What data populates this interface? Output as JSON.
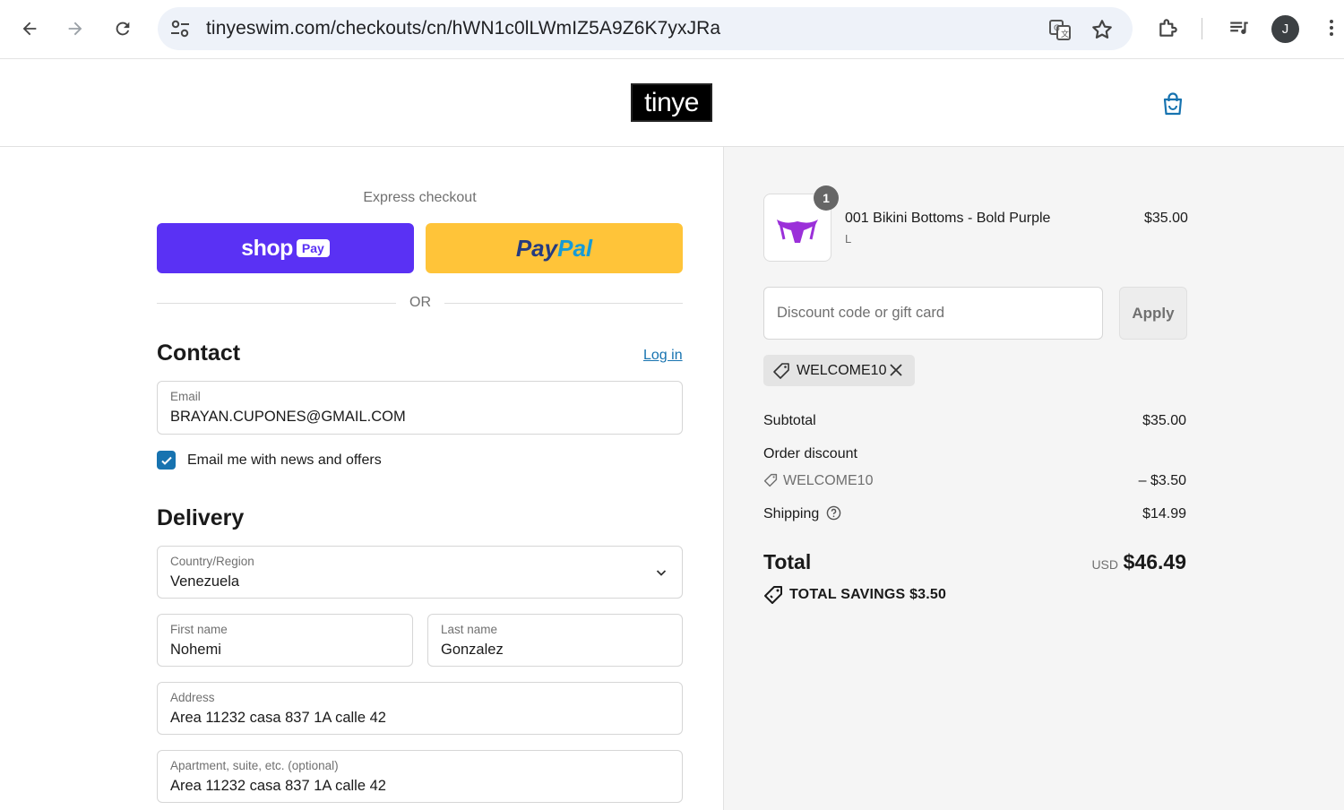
{
  "browser": {
    "url": "tinyeswim.com/checkouts/cn/hWN1c0lLWmIZ5A9Z6K7yxJRa",
    "avatar_initial": "J",
    "icons": [
      "back-arrow-icon",
      "forward-arrow-icon",
      "reload-icon",
      "site-settings-icon",
      "translate-icon",
      "star-icon",
      "extensions-icon",
      "media-queue-icon",
      "more-vert-icon"
    ]
  },
  "shop": {
    "logo_text": "tinye",
    "cart_icon": "bag-icon"
  },
  "checkout": {
    "express_title": "Express checkout",
    "shop_pay": {
      "word": "shop",
      "badge": "Pay"
    },
    "paypal": {
      "part1": "Pay",
      "part2": "Pal"
    },
    "or_text": "OR",
    "contact": {
      "title": "Contact",
      "login_link": "Log in",
      "email_label": "Email",
      "email_value": "BRAYAN.CUPONES@GMAIL.COM",
      "newsletter_label": "Email me with news and offers",
      "newsletter_checked": true
    },
    "delivery": {
      "title": "Delivery",
      "country_label": "Country/Region",
      "country_value": "Venezuela",
      "first_name_label": "First name",
      "first_name_value": "Nohemi",
      "last_name_label": "Last name",
      "last_name_value": "Gonzalez",
      "address_label": "Address",
      "address_value": "Area 11232 casa 837 1A calle 42",
      "apartment_label": "Apartment, suite, etc. (optional)",
      "apartment_value": "Area 11232 casa 837 1A calle 42"
    }
  },
  "summary": {
    "item": {
      "quantity": "1",
      "name": "001 Bikini Bottoms - Bold Purple",
      "variant": "L",
      "price": "$35.00"
    },
    "discount_placeholder": "Discount code or gift card",
    "apply_label": "Apply",
    "applied_code": "WELCOME10",
    "subtotal_label": "Subtotal",
    "subtotal_value": "$35.00",
    "order_discount_label": "Order discount",
    "discount_code": "WELCOME10",
    "discount_value": "– $3.50",
    "shipping_label": "Shipping",
    "shipping_value": "$14.99",
    "total_label": "Total",
    "total_currency": "USD",
    "total_value": "$46.49",
    "savings_text": "TOTAL SAVINGS  $3.50"
  },
  "colors": {
    "shop_pay": "#5a31f4",
    "paypal": "#ffc439",
    "link": "#1773b0",
    "product_purple": "#9b30d9"
  }
}
